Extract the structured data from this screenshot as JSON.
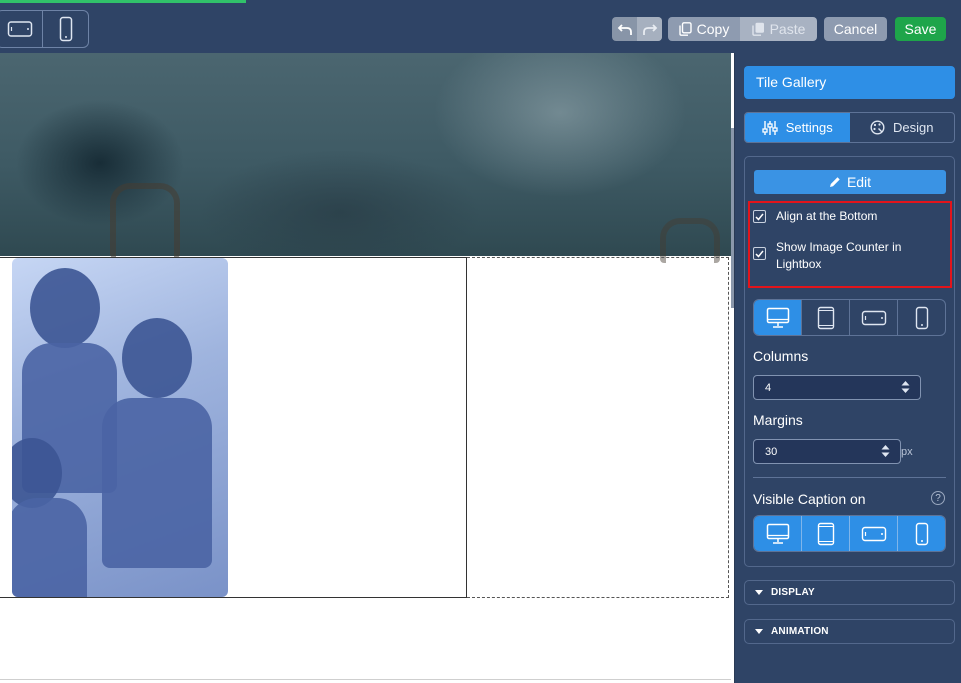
{
  "toolbar": {
    "copy_label": "Copy",
    "paste_label": "Paste",
    "cancel_label": "Cancel",
    "save_label": "Save",
    "icons": [
      "tablet-landscape-icon",
      "phone-icon",
      "undo-icon",
      "redo-icon",
      "copy-icon",
      "paste-icon"
    ]
  },
  "panel": {
    "title": "Tile Gallery",
    "tabs": [
      {
        "label": "Settings",
        "icon": "sliders-icon",
        "active": true
      },
      {
        "label": "Design",
        "icon": "palette-icon",
        "active": false
      }
    ],
    "edit_label": "Edit",
    "options": [
      {
        "label": "Align at the Bottom",
        "checked": true
      },
      {
        "label": "Show Image Counter in Lightbox",
        "checked": true
      }
    ],
    "columns": {
      "label": "Columns",
      "value": "4"
    },
    "margins": {
      "label": "Margins",
      "value": "30",
      "unit": "px"
    },
    "visible_caption": {
      "label": "Visible Caption on",
      "help": "?"
    },
    "sections": [
      "DISPLAY",
      "ANIMATION"
    ]
  },
  "colors": {
    "toolbar_bg": "#2f4466",
    "accent": "#2e8fe6",
    "save": "#1ea54a",
    "highlight": "#e3141b"
  }
}
